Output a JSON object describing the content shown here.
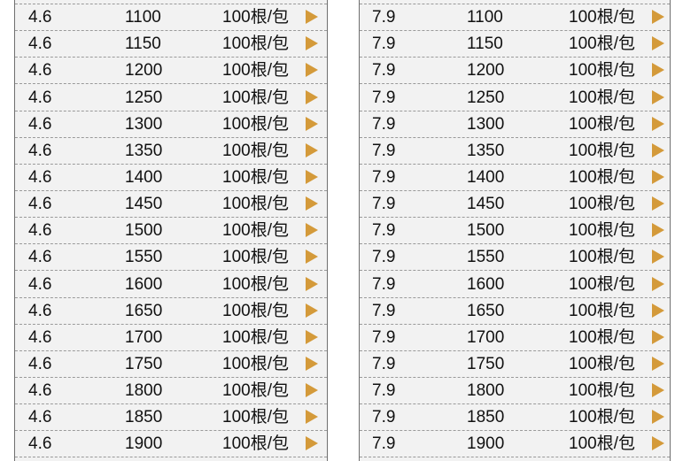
{
  "colors": {
    "arrow": "#d49a3a",
    "panel_bg": "#f2f2f2",
    "border": "#6f6f6f"
  },
  "left_table": {
    "rows": [
      {
        "spec": "4.6",
        "length": "1100",
        "pack": "100根/包"
      },
      {
        "spec": "4.6",
        "length": "1150",
        "pack": "100根/包"
      },
      {
        "spec": "4.6",
        "length": "1200",
        "pack": "100根/包"
      },
      {
        "spec": "4.6",
        "length": "1250",
        "pack": "100根/包"
      },
      {
        "spec": "4.6",
        "length": "1300",
        "pack": "100根/包"
      },
      {
        "spec": "4.6",
        "length": "1350",
        "pack": "100根/包"
      },
      {
        "spec": "4.6",
        "length": "1400",
        "pack": "100根/包"
      },
      {
        "spec": "4.6",
        "length": "1450",
        "pack": "100根/包"
      },
      {
        "spec": "4.6",
        "length": "1500",
        "pack": "100根/包"
      },
      {
        "spec": "4.6",
        "length": "1550",
        "pack": "100根/包"
      },
      {
        "spec": "4.6",
        "length": "1600",
        "pack": "100根/包"
      },
      {
        "spec": "4.6",
        "length": "1650",
        "pack": "100根/包"
      },
      {
        "spec": "4.6",
        "length": "1700",
        "pack": "100根/包"
      },
      {
        "spec": "4.6",
        "length": "1750",
        "pack": "100根/包"
      },
      {
        "spec": "4.6",
        "length": "1800",
        "pack": "100根/包"
      },
      {
        "spec": "4.6",
        "length": "1850",
        "pack": "100根/包"
      },
      {
        "spec": "4.6",
        "length": "1900",
        "pack": "100根/包"
      }
    ]
  },
  "right_table": {
    "rows": [
      {
        "spec": "7.9",
        "length": "1100",
        "pack": "100根/包"
      },
      {
        "spec": "7.9",
        "length": "1150",
        "pack": "100根/包"
      },
      {
        "spec": "7.9",
        "length": "1200",
        "pack": "100根/包"
      },
      {
        "spec": "7.9",
        "length": "1250",
        "pack": "100根/包"
      },
      {
        "spec": "7.9",
        "length": "1300",
        "pack": "100根/包"
      },
      {
        "spec": "7.9",
        "length": "1350",
        "pack": "100根/包"
      },
      {
        "spec": "7.9",
        "length": "1400",
        "pack": "100根/包"
      },
      {
        "spec": "7.9",
        "length": "1450",
        "pack": "100根/包"
      },
      {
        "spec": "7.9",
        "length": "1500",
        "pack": "100根/包"
      },
      {
        "spec": "7.9",
        "length": "1550",
        "pack": "100根/包"
      },
      {
        "spec": "7.9",
        "length": "1600",
        "pack": "100根/包"
      },
      {
        "spec": "7.9",
        "length": "1650",
        "pack": "100根/包"
      },
      {
        "spec": "7.9",
        "length": "1700",
        "pack": "100根/包"
      },
      {
        "spec": "7.9",
        "length": "1750",
        "pack": "100根/包"
      },
      {
        "spec": "7.9",
        "length": "1800",
        "pack": "100根/包"
      },
      {
        "spec": "7.9",
        "length": "1850",
        "pack": "100根/包"
      },
      {
        "spec": "7.9",
        "length": "1900",
        "pack": "100根/包"
      }
    ]
  }
}
